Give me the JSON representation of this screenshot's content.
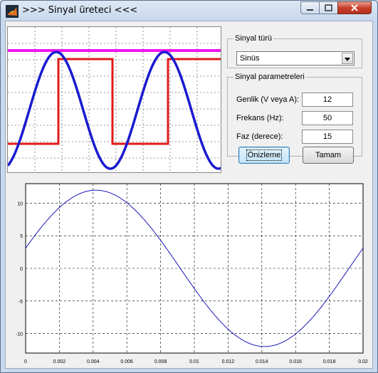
{
  "window": {
    "title": ">>> Sinyal üreteci <<<",
    "icon": "matlab-icon",
    "controls": {
      "minimize": "minimize-icon",
      "maximize": "maximize-icon",
      "close": "close-icon"
    }
  },
  "preview": {
    "description_icons": [
      "sine-wave",
      "square-wave",
      "dc-level"
    ],
    "colors": {
      "sine": "#1a1ad0",
      "square": "#e01a1a",
      "dc": "#f015f0"
    }
  },
  "signal_type": {
    "legend": "Sinyal türü",
    "selected": "Sinüs"
  },
  "parameters": {
    "legend": "Sinyal parametreleri",
    "amplitude": {
      "label": "Genlik (V veya A):",
      "value": "12"
    },
    "frequency": {
      "label": "Frekans (Hz):",
      "value": "50"
    },
    "phase": {
      "label": "Faz (derece):",
      "value": "15"
    }
  },
  "buttons": {
    "preview": "Önizleme",
    "ok": "Tamam"
  },
  "chart_data": {
    "type": "line",
    "title": "",
    "xlabel": "",
    "ylabel": "",
    "xlim": [
      0,
      0.02
    ],
    "ylim": [
      -13,
      13
    ],
    "xticks": [
      "0",
      "0.002",
      "0.004",
      "0.006",
      "0.008",
      "0.01",
      "0.012",
      "0.014",
      "0.016",
      "0.018",
      "0.02"
    ],
    "yticks": [
      "10",
      "5",
      "0",
      "-5",
      "-10"
    ],
    "grid": true,
    "series": [
      {
        "function": "12*sin(2*pi*50*t + 15deg)",
        "amplitude": 12,
        "frequency_hz": 50,
        "phase_deg": 15,
        "color": "#0000b0"
      }
    ]
  }
}
